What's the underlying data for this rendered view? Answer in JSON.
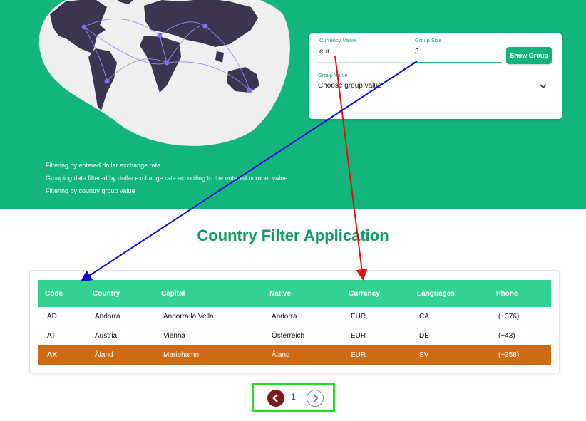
{
  "hero": {
    "features": [
      "Filtering by entered dollar exchange rate",
      "Grouping data filtered by dollar exchange rate according to the entered number value",
      "Filtering by country group value"
    ]
  },
  "filter": {
    "currency_label": "Currency Value",
    "currency_value": "eur",
    "group_size_label": "Group Size",
    "group_size_value": "3",
    "show_group_label": "Show Group",
    "group_value_label": "Group Value",
    "group_value_selected": "Choose group value"
  },
  "page_title": "Country Filter Application",
  "table": {
    "headers": [
      "Code",
      "Country",
      "Capital",
      "Native",
      "Currency",
      "Languages",
      "Phone"
    ],
    "rows": [
      [
        "AD",
        "Andorra",
        "Andorra la Vella",
        "Andorra",
        "EUR",
        "CA",
        "(+376)"
      ],
      [
        "AT",
        "Austria",
        "Vienna",
        "Österreich",
        "EUR",
        "DE",
        "(+43)"
      ],
      [
        "AX",
        "Åland",
        "Mariehamn",
        "Åland",
        "EUR",
        "SV",
        "(+358)"
      ]
    ],
    "highlight_color": "#cd6a14"
  },
  "pagination": {
    "current_page": "1"
  },
  "colors": {
    "brand": "#12b67d",
    "header": "#33d293",
    "title": "#119a68",
    "annotation_red": "#e01010",
    "annotation_blue": "#0a0ad0",
    "annotation_green": "#22dd22"
  },
  "icons": [
    "world-map-illustration",
    "chevron-down-icon",
    "chevron-left-icon",
    "chevron-right-icon"
  ]
}
